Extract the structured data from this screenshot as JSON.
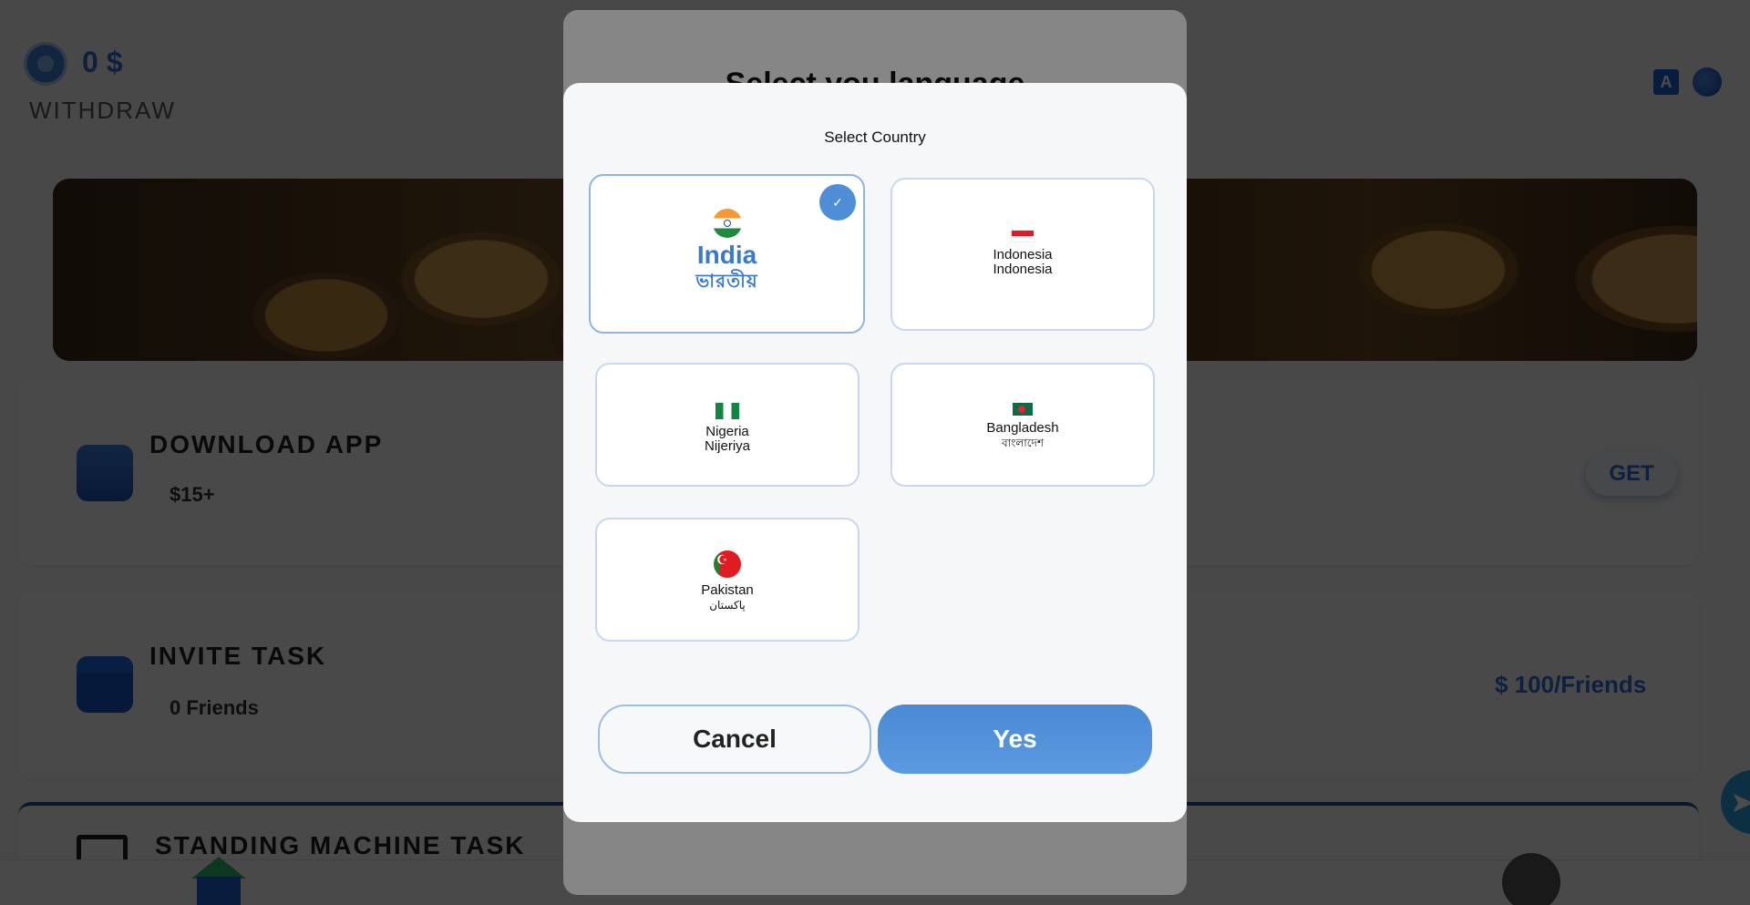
{
  "header": {
    "balance": "0 $",
    "withdraw_label": "WITHDRAW",
    "lang_icon_glyph": "A"
  },
  "tasks": {
    "download": {
      "title": "DOWNLOAD APP",
      "reward": "$15+",
      "button": "GET"
    },
    "invite": {
      "title": "INVITE TASK",
      "friends": "0 Friends",
      "reward": "$ 100/Friends"
    },
    "standing": {
      "title": "STANDING MACHINE TASK"
    }
  },
  "back_modal": {
    "title": "Select you language"
  },
  "modal": {
    "title": "Select Country",
    "countries": [
      {
        "name": "India",
        "native": "ভারতীয়",
        "selected": true,
        "flag": "india-flag-icon"
      },
      {
        "name": "Indonesia",
        "native": "Indonesia",
        "selected": false,
        "flag": "indonesia-flag-icon"
      },
      {
        "name": "Nigeria",
        "native": "Nijeriya",
        "selected": false,
        "flag": "nigeria-flag-icon"
      },
      {
        "name": "Bangladesh",
        "native": "বাংলাদেশ",
        "selected": false,
        "flag": "bangladesh-flag-icon"
      },
      {
        "name": "Pakistan",
        "native": "پاکستان",
        "selected": false,
        "flag": "pakistan-flag-icon"
      }
    ],
    "cancel_label": "Cancel",
    "confirm_label": "Yes"
  },
  "colors": {
    "accent": "#2f72d2",
    "selected_text": "#3b7ac8",
    "yes_button": "#4a8ad4"
  }
}
